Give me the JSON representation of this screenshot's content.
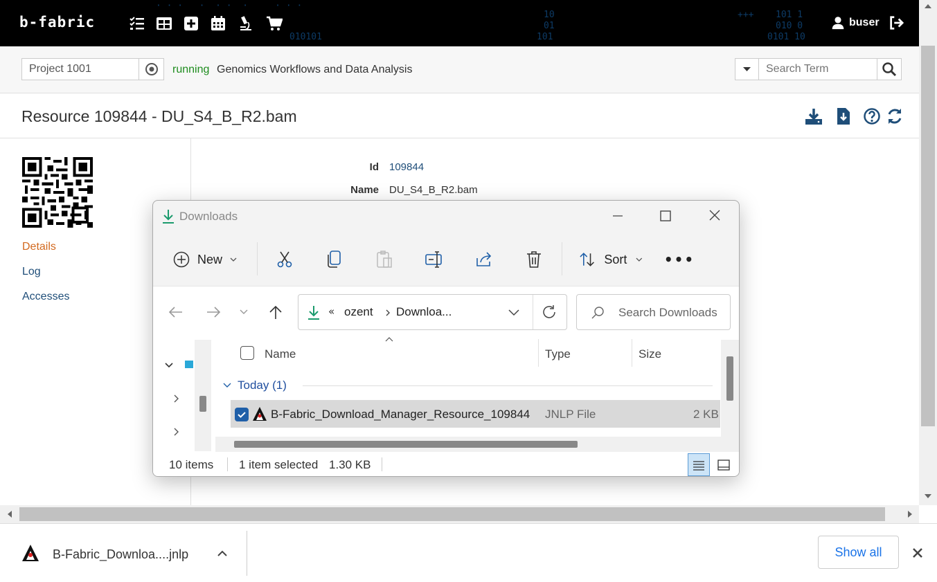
{
  "header": {
    "logo": "b-fabric",
    "user": "buser",
    "bits": [
      "10",
      "01",
      "101",
      "010101",
      "101 1",
      "010 0",
      "0101 10",
      "+++"
    ]
  },
  "project": {
    "value": "Project 1001",
    "status": "running",
    "name": "Genomics Workflows and Data Analysis"
  },
  "search": {
    "placeholder": "Search Term"
  },
  "page": {
    "title": "Resource 109844 - DU_S4_B_R2.bam"
  },
  "sidebar": {
    "items": [
      {
        "label": "Details"
      },
      {
        "label": "Log"
      },
      {
        "label": "Accesses"
      }
    ]
  },
  "details": [
    {
      "label": "Id",
      "value": "109844"
    },
    {
      "label": "Name",
      "value": "DU_S4_B_R2.bam"
    }
  ],
  "explorer": {
    "title": "Downloads",
    "new_label": "New",
    "sort_label": "Sort",
    "more_label": "•••",
    "breadcrumb_prefix": "«",
    "breadcrumb": [
      "ozent",
      "Downloa..."
    ],
    "search_placeholder": "Search Downloads",
    "columns": {
      "name": "Name",
      "type": "Type",
      "size": "Size"
    },
    "group": "Today (1)",
    "file": {
      "name": "B-Fabric_Download_Manager_Resource_109844",
      "type": "JNLP File",
      "size": "2 KB"
    },
    "status": {
      "count": "10 items",
      "selected": "1 item selected",
      "size": "1.30 KB"
    }
  },
  "download_bar": {
    "file": "B-Fabric_Downloa....jnlp",
    "show_all": "Show all"
  },
  "colors": {
    "accent": "#1a73e8",
    "running": "#1e8c1e",
    "active_link": "#d2691e",
    "link": "#1f4e79"
  }
}
